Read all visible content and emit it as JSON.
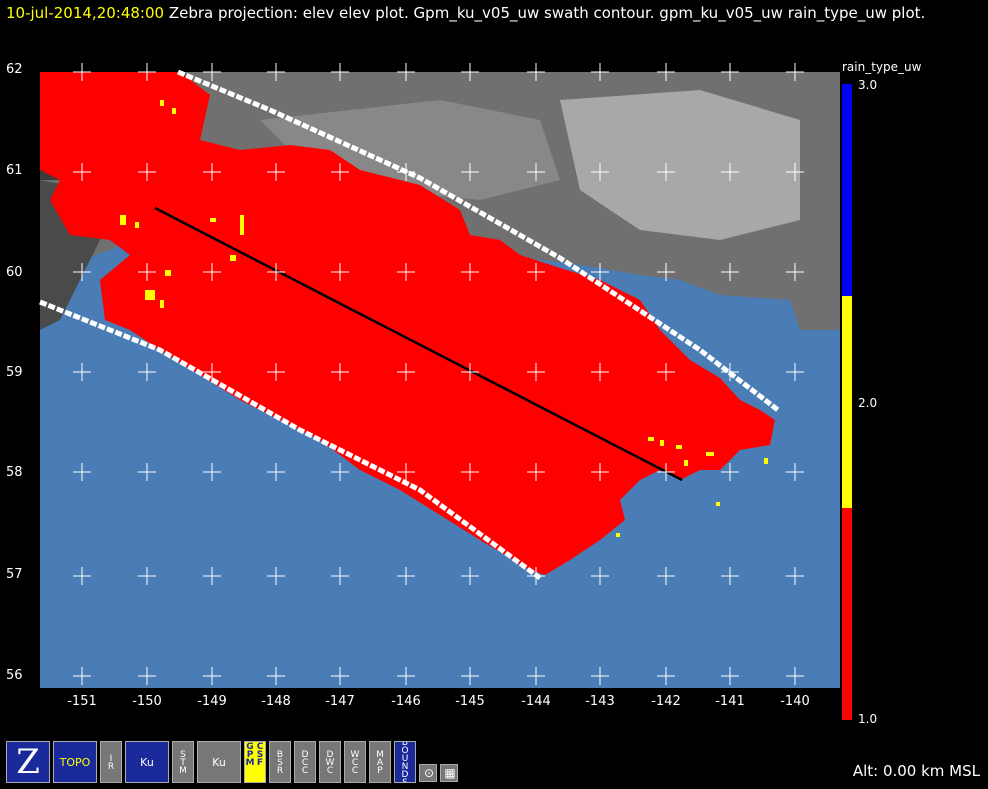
{
  "header": {
    "time": "10-jul-2014,20:48:00",
    "title": " Zebra projection: elev elev  plot.  Gpm_ku_v05_uw swath contour.  gpm_ku_v05_uw rain_type_uw  plot."
  },
  "axes": {
    "lat_ticks": [
      "62",
      "61",
      "60",
      "59",
      "58",
      "57",
      "56"
    ],
    "lon_ticks": [
      "-151",
      "-150",
      "-149",
      "-148",
      "-147",
      "-146",
      "-145",
      "-144",
      "-143",
      "-142",
      "-141",
      "-140"
    ]
  },
  "legend": {
    "title": "rain_type_uw",
    "ticks": [
      "3.0",
      "2.0",
      "1.0"
    ],
    "colors": {
      "stratiform": "#ff0000",
      "convective": "#ffff00",
      "other": "#0000ff"
    }
  },
  "colors": {
    "ocean": "#4a7db5",
    "rain": "#ff0000",
    "swath_edge": "#ffffff",
    "track": "#000000"
  },
  "toolbar": {
    "items": [
      {
        "name": "zebra-icon",
        "label": "Z"
      },
      {
        "name": "topo-button",
        "label": "TOPO"
      },
      {
        "name": "ir-button",
        "label": "IR"
      },
      {
        "name": "ku-button",
        "label": "Ku"
      },
      {
        "name": "stm-button",
        "label": "STM"
      },
      {
        "name": "ku2-button",
        "label": "Ku"
      },
      {
        "name": "csf-gpm-button",
        "label": "CSF GPM"
      },
      {
        "name": "bsr-button",
        "label": "BSR"
      },
      {
        "name": "dcc-button",
        "label": "DCC"
      },
      {
        "name": "dwc-button",
        "label": "DWC"
      },
      {
        "name": "wcc-button",
        "label": "WCC"
      },
      {
        "name": "map-button",
        "label": "MAP"
      },
      {
        "name": "bounds-button",
        "label": "BOUNDS"
      }
    ]
  },
  "status": {
    "altitude": "Alt: 0.00 km MSL"
  }
}
